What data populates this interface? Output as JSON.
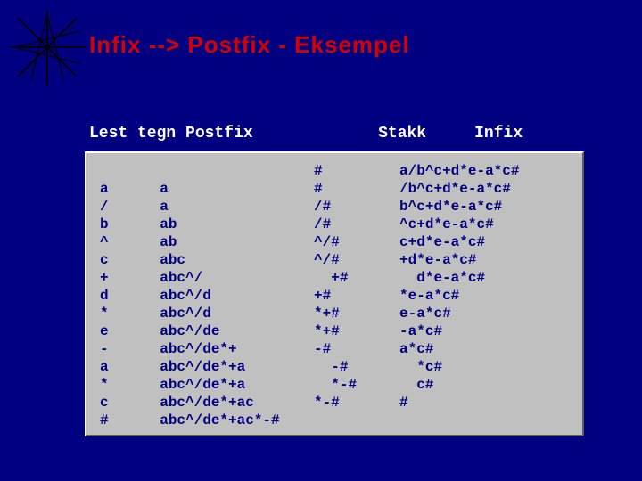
{
  "title": "Infix  -->  Postfix  -  Eksempel",
  "headers": {
    "col1": "Lest tegn",
    "col2": "Postfix",
    "col3": "Stakk",
    "col4": "Infix"
  },
  "rows": [
    {
      "read": "",
      "postfix": "",
      "stack": "#",
      "infix": "a/b^c+d*e-a*c#"
    },
    {
      "read": "a",
      "postfix": "a",
      "stack": "#",
      "infix": "/b^c+d*e-a*c#"
    },
    {
      "read": "/",
      "postfix": "a",
      "stack": "/#",
      "infix": "b^c+d*e-a*c#"
    },
    {
      "read": "b",
      "postfix": "ab",
      "stack": "/#",
      "infix": "^c+d*e-a*c#"
    },
    {
      "read": "^",
      "postfix": "ab",
      "stack": "^/#",
      "infix": "c+d*e-a*c#"
    },
    {
      "read": "c",
      "postfix": "abc",
      "stack": "^/#",
      "infix": "+d*e-a*c#"
    },
    {
      "read": "+",
      "postfix": "abc^/",
      "stack": "  +#",
      "infix": "  d*e-a*c#"
    },
    {
      "read": "d",
      "postfix": "abc^/d",
      "stack": "+#",
      "infix": "*e-a*c#"
    },
    {
      "read": "*",
      "postfix": "abc^/d",
      "stack": "*+#",
      "infix": "e-a*c#"
    },
    {
      "read": "e",
      "postfix": "abc^/de",
      "stack": "*+#",
      "infix": "-a*c#"
    },
    {
      "read": "-",
      "postfix": "abc^/de*+",
      "stack": "-#",
      "infix": "a*c#"
    },
    {
      "read": "a",
      "postfix": "abc^/de*+a",
      "stack": "  -#",
      "infix": "  *c#"
    },
    {
      "read": "*",
      "postfix": "abc^/de*+a",
      "stack": "  *-#",
      "infix": "  c#"
    },
    {
      "read": "c",
      "postfix": "abc^/de*+ac",
      "stack": "*-#",
      "infix": "#"
    },
    {
      "read": "#",
      "postfix": "abc^/de*+ac*-#",
      "stack": "",
      "infix": ""
    }
  ]
}
